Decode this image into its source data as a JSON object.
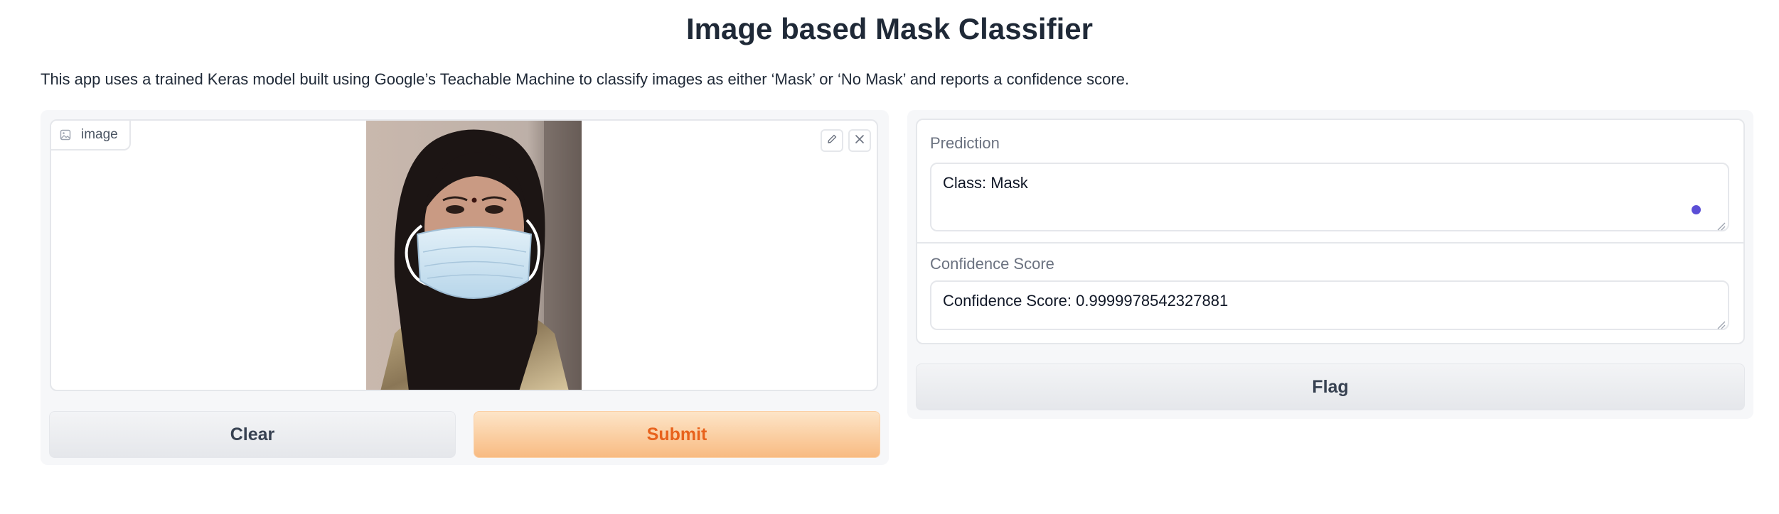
{
  "header": {
    "title": "Image based Mask Classifier",
    "description": "This app uses a trained Keras model built using Google’s Teachable Machine to classify images as either ‘Mask’ or ‘No Mask’ and reports a confidence score."
  },
  "input": {
    "image_label": "image",
    "image_icon": "image-icon",
    "edit_icon": "pencil-icon",
    "clear_icon": "close-icon",
    "photo_description_icon": "uploaded-photo"
  },
  "buttons": {
    "clear": "Clear",
    "submit": "Submit",
    "flag": "Flag"
  },
  "outputs": {
    "prediction_label": "Prediction",
    "prediction_value": "Class: Mask",
    "confidence_label": "Confidence Score",
    "confidence_value": "Confidence Score: 0.9999978542327881"
  },
  "colors": {
    "submit_text": "#e8621c",
    "submit_bg": "#f8bb82",
    "status_dot": "#5b4ed6"
  }
}
